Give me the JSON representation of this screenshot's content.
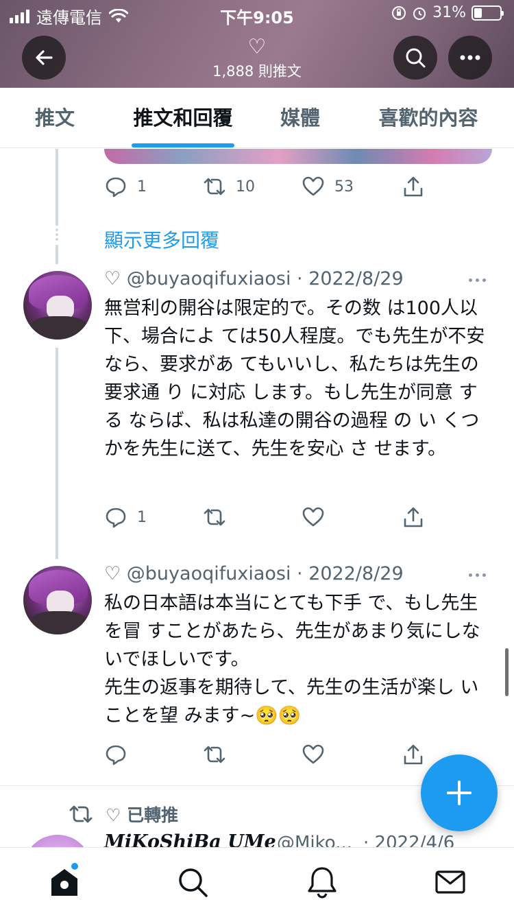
{
  "status_bar": {
    "carrier": "遠傳電信",
    "time": "下午9:05",
    "battery": "31%"
  },
  "header": {
    "heart_symbol": "♡",
    "tweet_count": "1,888 則推文",
    "icons": [
      "back-arrow-icon",
      "search-icon",
      "more-icon"
    ]
  },
  "tabs": [
    {
      "label": "推文",
      "active": false
    },
    {
      "label": "推文和回覆",
      "active": true
    },
    {
      "label": "媒體",
      "active": false
    },
    {
      "label": "喜歡的內容",
      "active": false
    }
  ],
  "first_tweet_actions": {
    "reply_count": "1",
    "retweet_count": "10",
    "like_count": "53"
  },
  "show_more_replies": "顯示更多回覆",
  "tweets": [
    {
      "author_meta": "♡ @buyaoqifuxiaosi · 2022/8/29",
      "text": "無営利の開谷は限定的で。その数 は100人以下、場合によ ては50人程度。でも先生が不安なら、要求があ てもいいし、私たちは先生の要求通 り に対応 します。もし先生が同意 す る ならば、私は私達の開谷の過程 の い くつかを先生に送て、先生を安心 さ せます。",
      "reply_count": "1"
    },
    {
      "author_meta": "♡ @buyaoqifuxiaosi · 2022/8/29",
      "text": "私の日本語は本当にとても下手 で、もし先生を冒 すことがあたら、先生があまり気にしないでほしいです。\n先生の返事を期待して、先生の生活が楽し いことを望 みます~🥺🥺",
      "reply_count": ""
    }
  ],
  "retweet_notice": "♡ 已轉推",
  "peek_tweet": {
    "name": "MiKoShiBa UMe",
    "handle": "@Miko...",
    "date": "· 2022/4/6"
  },
  "colors": {
    "accent": "#1d9bf0",
    "text": "#0f1419",
    "secondary": "#536471"
  },
  "bottom_nav": [
    "home-icon",
    "search-icon",
    "notifications-icon",
    "messages-icon"
  ]
}
